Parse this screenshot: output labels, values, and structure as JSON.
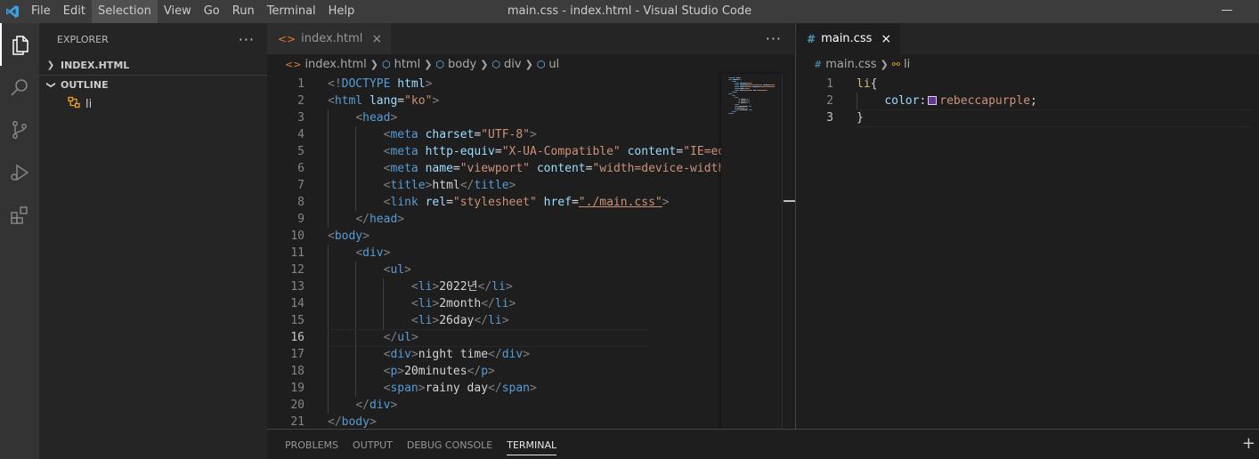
{
  "app": {
    "window_title": "main.css - index.html - Visual Studio Code",
    "menu": [
      "File",
      "Edit",
      "Selection",
      "View",
      "Go",
      "Run",
      "Terminal",
      "Help"
    ],
    "active_menu": "Selection",
    "accent_color": "#0078d4"
  },
  "activity_bar": {
    "items": [
      "explorer-icon",
      "search-icon",
      "source-control-icon",
      "run-debug-icon",
      "extensions-icon"
    ]
  },
  "sidebar": {
    "title": "EXPLORER",
    "more": "···",
    "folder": "INDEX.HTML",
    "outline_title": "OUTLINE",
    "outline_item": "li"
  },
  "editor1": {
    "tab_label": "index.html",
    "tab_close": "×",
    "more": "···",
    "breadcrumbs": [
      "index.html",
      "html",
      "body",
      "div",
      "ul"
    ],
    "current_line": 16,
    "lines": [
      [
        [
          "tg",
          "<!"
        ],
        [
          "tn",
          "DOCTYPE"
        ],
        [
          "tx",
          " "
        ],
        [
          "at",
          "html"
        ],
        [
          "tg",
          ">"
        ]
      ],
      [
        [
          "tg",
          "<"
        ],
        [
          "tn",
          "html"
        ],
        [
          "tx",
          " "
        ],
        [
          "at",
          "lang"
        ],
        [
          "tx",
          "="
        ],
        [
          "sv",
          "\"ko\""
        ],
        [
          "tg",
          ">"
        ]
      ],
      [
        [
          "tx",
          "    "
        ],
        [
          "tg",
          "<"
        ],
        [
          "tn",
          "head"
        ],
        [
          "tg",
          ">"
        ]
      ],
      [
        [
          "tx",
          "        "
        ],
        [
          "tg",
          "<"
        ],
        [
          "tn",
          "meta"
        ],
        [
          "tx",
          " "
        ],
        [
          "at",
          "charset"
        ],
        [
          "tx",
          "="
        ],
        [
          "sv",
          "\"UTF-8\""
        ],
        [
          "tg",
          ">"
        ]
      ],
      [
        [
          "tx",
          "        "
        ],
        [
          "tg",
          "<"
        ],
        [
          "tn",
          "meta"
        ],
        [
          "tx",
          " "
        ],
        [
          "at",
          "http-equiv"
        ],
        [
          "tx",
          "="
        ],
        [
          "sv",
          "\"X-UA-Compatible\""
        ],
        [
          "tx",
          " "
        ],
        [
          "at",
          "content"
        ],
        [
          "tx",
          "="
        ],
        [
          "sv",
          "\"IE=edg"
        ]
      ],
      [
        [
          "tx",
          "        "
        ],
        [
          "tg",
          "<"
        ],
        [
          "tn",
          "meta"
        ],
        [
          "tx",
          " "
        ],
        [
          "at",
          "name"
        ],
        [
          "tx",
          "="
        ],
        [
          "sv",
          "\"viewport\""
        ],
        [
          "tx",
          " "
        ],
        [
          "at",
          "content"
        ],
        [
          "tx",
          "="
        ],
        [
          "sv",
          "\"width=device-width\""
        ]
      ],
      [
        [
          "tx",
          "        "
        ],
        [
          "tg",
          "<"
        ],
        [
          "tn",
          "title"
        ],
        [
          "tg",
          ">"
        ],
        [
          "tx",
          "html"
        ],
        [
          "tg",
          "</"
        ],
        [
          "tn",
          "title"
        ],
        [
          "tg",
          ">"
        ]
      ],
      [
        [
          "tx",
          "        "
        ],
        [
          "tg",
          "<"
        ],
        [
          "tn",
          "link"
        ],
        [
          "tx",
          " "
        ],
        [
          "at",
          "rel"
        ],
        [
          "tx",
          "="
        ],
        [
          "sv",
          "\"stylesheet\""
        ],
        [
          "tx",
          " "
        ],
        [
          "at",
          "href"
        ],
        [
          "tx",
          "="
        ],
        [
          "sv",
          "\"./main.css\""
        ],
        [
          "tg",
          ">"
        ]
      ],
      [
        [
          "tx",
          "    "
        ],
        [
          "tg",
          "</"
        ],
        [
          "tn",
          "head"
        ],
        [
          "tg",
          ">"
        ]
      ],
      [
        [
          "tg",
          "<"
        ],
        [
          "tn",
          "body"
        ],
        [
          "tg",
          ">"
        ]
      ],
      [
        [
          "tx",
          "    "
        ],
        [
          "tg",
          "<"
        ],
        [
          "tn",
          "div"
        ],
        [
          "tg",
          ">"
        ]
      ],
      [
        [
          "tx",
          "        "
        ],
        [
          "tg",
          "<"
        ],
        [
          "tn",
          "ul"
        ],
        [
          "tg",
          ">"
        ]
      ],
      [
        [
          "tx",
          "            "
        ],
        [
          "tg",
          "<"
        ],
        [
          "tn",
          "li"
        ],
        [
          "tg",
          ">"
        ],
        [
          "tx",
          "2022년"
        ],
        [
          "tg",
          "</"
        ],
        [
          "tn",
          "li"
        ],
        [
          "tg",
          ">"
        ]
      ],
      [
        [
          "tx",
          "            "
        ],
        [
          "tg",
          "<"
        ],
        [
          "tn",
          "li"
        ],
        [
          "tg",
          ">"
        ],
        [
          "tx",
          "2month"
        ],
        [
          "tg",
          "</"
        ],
        [
          "tn",
          "li"
        ],
        [
          "tg",
          ">"
        ]
      ],
      [
        [
          "tx",
          "            "
        ],
        [
          "tg",
          "<"
        ],
        [
          "tn",
          "li"
        ],
        [
          "tg",
          ">"
        ],
        [
          "tx",
          "26day"
        ],
        [
          "tg",
          "</"
        ],
        [
          "tn",
          "li"
        ],
        [
          "tg",
          ">"
        ]
      ],
      [
        [
          "tx",
          "        "
        ],
        [
          "tg",
          "</"
        ],
        [
          "tn",
          "ul"
        ],
        [
          "tg",
          ">"
        ]
      ],
      [
        [
          "tx",
          "        "
        ],
        [
          "tg",
          "<"
        ],
        [
          "tn",
          "div"
        ],
        [
          "tg",
          ">"
        ],
        [
          "tx",
          "night time"
        ],
        [
          "tg",
          "</"
        ],
        [
          "tn",
          "div"
        ],
        [
          "tg",
          ">"
        ]
      ],
      [
        [
          "tx",
          "        "
        ],
        [
          "tg",
          "<"
        ],
        [
          "tn",
          "p"
        ],
        [
          "tg",
          ">"
        ],
        [
          "tx",
          "20minutes"
        ],
        [
          "tg",
          "</"
        ],
        [
          "tn",
          "p"
        ],
        [
          "tg",
          ">"
        ]
      ],
      [
        [
          "tx",
          "        "
        ],
        [
          "tg",
          "<"
        ],
        [
          "tn",
          "span"
        ],
        [
          "tg",
          ">"
        ],
        [
          "tx",
          "rainy day"
        ],
        [
          "tg",
          "</"
        ],
        [
          "tn",
          "span"
        ],
        [
          "tg",
          ">"
        ]
      ],
      [
        [
          "tx",
          "    "
        ],
        [
          "tg",
          "</"
        ],
        [
          "tn",
          "div"
        ],
        [
          "tg",
          ">"
        ]
      ],
      [
        [
          "tg",
          "</"
        ],
        [
          "tn",
          "body"
        ],
        [
          "tg",
          ">"
        ]
      ]
    ]
  },
  "editor2": {
    "tab_label": "main.css",
    "tab_close": "×",
    "breadcrumbs": [
      "main.css",
      "li"
    ],
    "current_line": 3,
    "swatch_color": "#663399",
    "lines": [
      [
        [
          "sel",
          "li"
        ],
        [
          "pun",
          "{"
        ]
      ],
      [
        [
          "tx",
          "    "
        ],
        [
          "prop",
          "color"
        ],
        [
          "pun",
          ":"
        ],
        [
          "swatch",
          ""
        ],
        [
          "val",
          "rebeccapurple"
        ],
        [
          "pun",
          ";"
        ]
      ],
      [
        [
          "pun",
          "}"
        ]
      ]
    ]
  },
  "panel": {
    "tabs": [
      "PROBLEMS",
      "OUTPUT",
      "DEBUG CONSOLE",
      "TERMINAL"
    ],
    "active_tab": "TERMINAL",
    "add": "+"
  }
}
